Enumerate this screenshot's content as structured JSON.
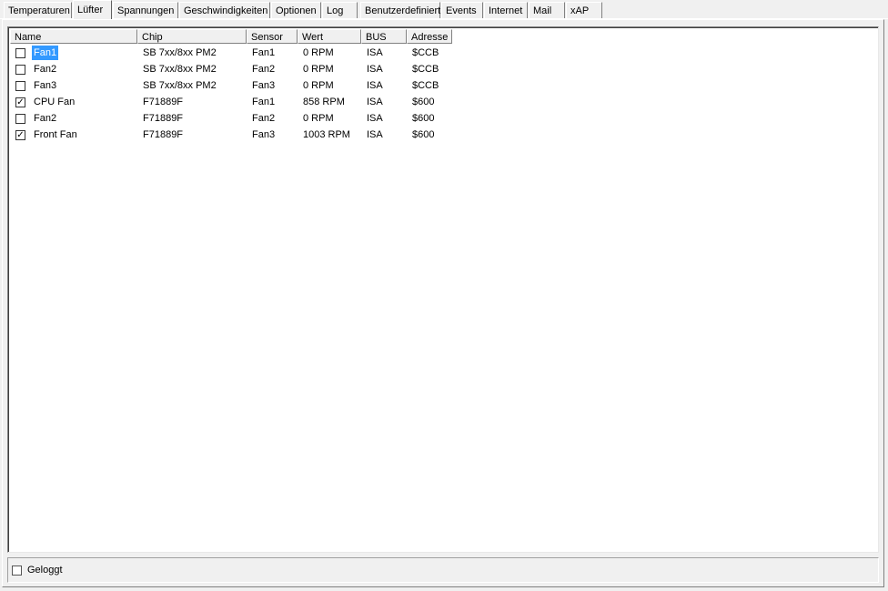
{
  "tabs": [
    {
      "label": "Temperaturen",
      "active": false
    },
    {
      "label": "Lüfter",
      "active": true
    },
    {
      "label": "Spannungen",
      "active": false
    },
    {
      "label": "Geschwindigkeiten",
      "active": false
    },
    {
      "label": "Optionen",
      "active": false
    },
    {
      "label": "Log",
      "active": false
    },
    {
      "label": "Benutzerdefiniert",
      "active": false
    },
    {
      "label": "Events",
      "active": false
    },
    {
      "label": "Internet",
      "active": false
    },
    {
      "label": "Mail",
      "active": false
    },
    {
      "label": "xAP",
      "active": false
    }
  ],
  "table": {
    "columns": [
      "Name",
      "Chip",
      "Sensor",
      "Wert",
      "BUS",
      "Adresse"
    ],
    "rows": [
      {
        "checked": false,
        "selected": true,
        "name": "Fan1",
        "chip": "SB 7xx/8xx PM2",
        "sensor": "Fan1",
        "wert": "0 RPM",
        "bus": "ISA",
        "adresse": "$CCB"
      },
      {
        "checked": false,
        "selected": false,
        "name": "Fan2",
        "chip": "SB 7xx/8xx PM2",
        "sensor": "Fan2",
        "wert": "0 RPM",
        "bus": "ISA",
        "adresse": "$CCB"
      },
      {
        "checked": false,
        "selected": false,
        "name": "Fan3",
        "chip": "SB 7xx/8xx PM2",
        "sensor": "Fan3",
        "wert": "0 RPM",
        "bus": "ISA",
        "adresse": "$CCB"
      },
      {
        "checked": true,
        "selected": false,
        "name": "CPU Fan",
        "chip": "F71889F",
        "sensor": "Fan1",
        "wert": "858 RPM",
        "bus": "ISA",
        "adresse": "$600"
      },
      {
        "checked": false,
        "selected": false,
        "name": "Fan2",
        "chip": "F71889F",
        "sensor": "Fan2",
        "wert": "0 RPM",
        "bus": "ISA",
        "adresse": "$600"
      },
      {
        "checked": true,
        "selected": false,
        "name": "Front Fan",
        "chip": "F71889F",
        "sensor": "Fan3",
        "wert": "1003 RPM",
        "bus": "ISA",
        "adresse": "$600"
      }
    ]
  },
  "footer": {
    "logged_label": "Geloggt",
    "logged_checked": false
  },
  "colors": {
    "selection": "#3399ff",
    "background": "#f0f0f0"
  }
}
